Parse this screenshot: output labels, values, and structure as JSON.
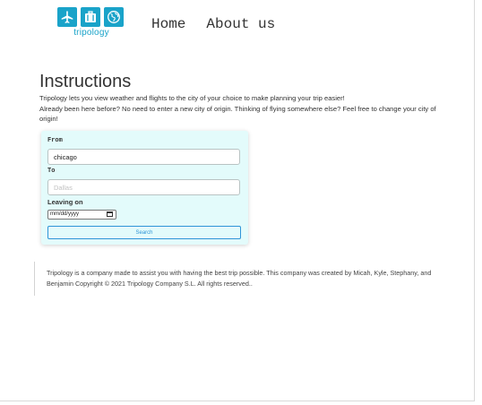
{
  "header": {
    "logo_text": "tripology",
    "nav": {
      "home": "Home",
      "about": "About us"
    }
  },
  "instructions": {
    "title": "Instructions",
    "line1": "Tripology lets you view weather and flights to the city of your choice to make planning your trip easier!",
    "line2": "Already been here before? No need to enter a new city of origin. Thinking of flying somewhere else? Feel free to change your city of origin!"
  },
  "form": {
    "from_label": "From",
    "from_value": "chicago",
    "to_label": "To",
    "to_placeholder": "Dallas",
    "leaving_label": "Leaving on",
    "date_placeholder": "mm/dd/yyyy",
    "search_label": "Search"
  },
  "footer": {
    "text": "Tripology is a company made to assist you with having the best trip possible. This company was created by Micah, Kyle, Stephany, and Benjamin Copyright © 2021 Tripology Company S.L. All rights reserved.."
  },
  "colors": {
    "brand": "#1aa3c9",
    "card_bg": "#e3fbfb",
    "button_border": "#2f94d8"
  },
  "icons": [
    "airplane-icon",
    "luggage-icon",
    "globe-icon",
    "calendar-icon"
  ]
}
